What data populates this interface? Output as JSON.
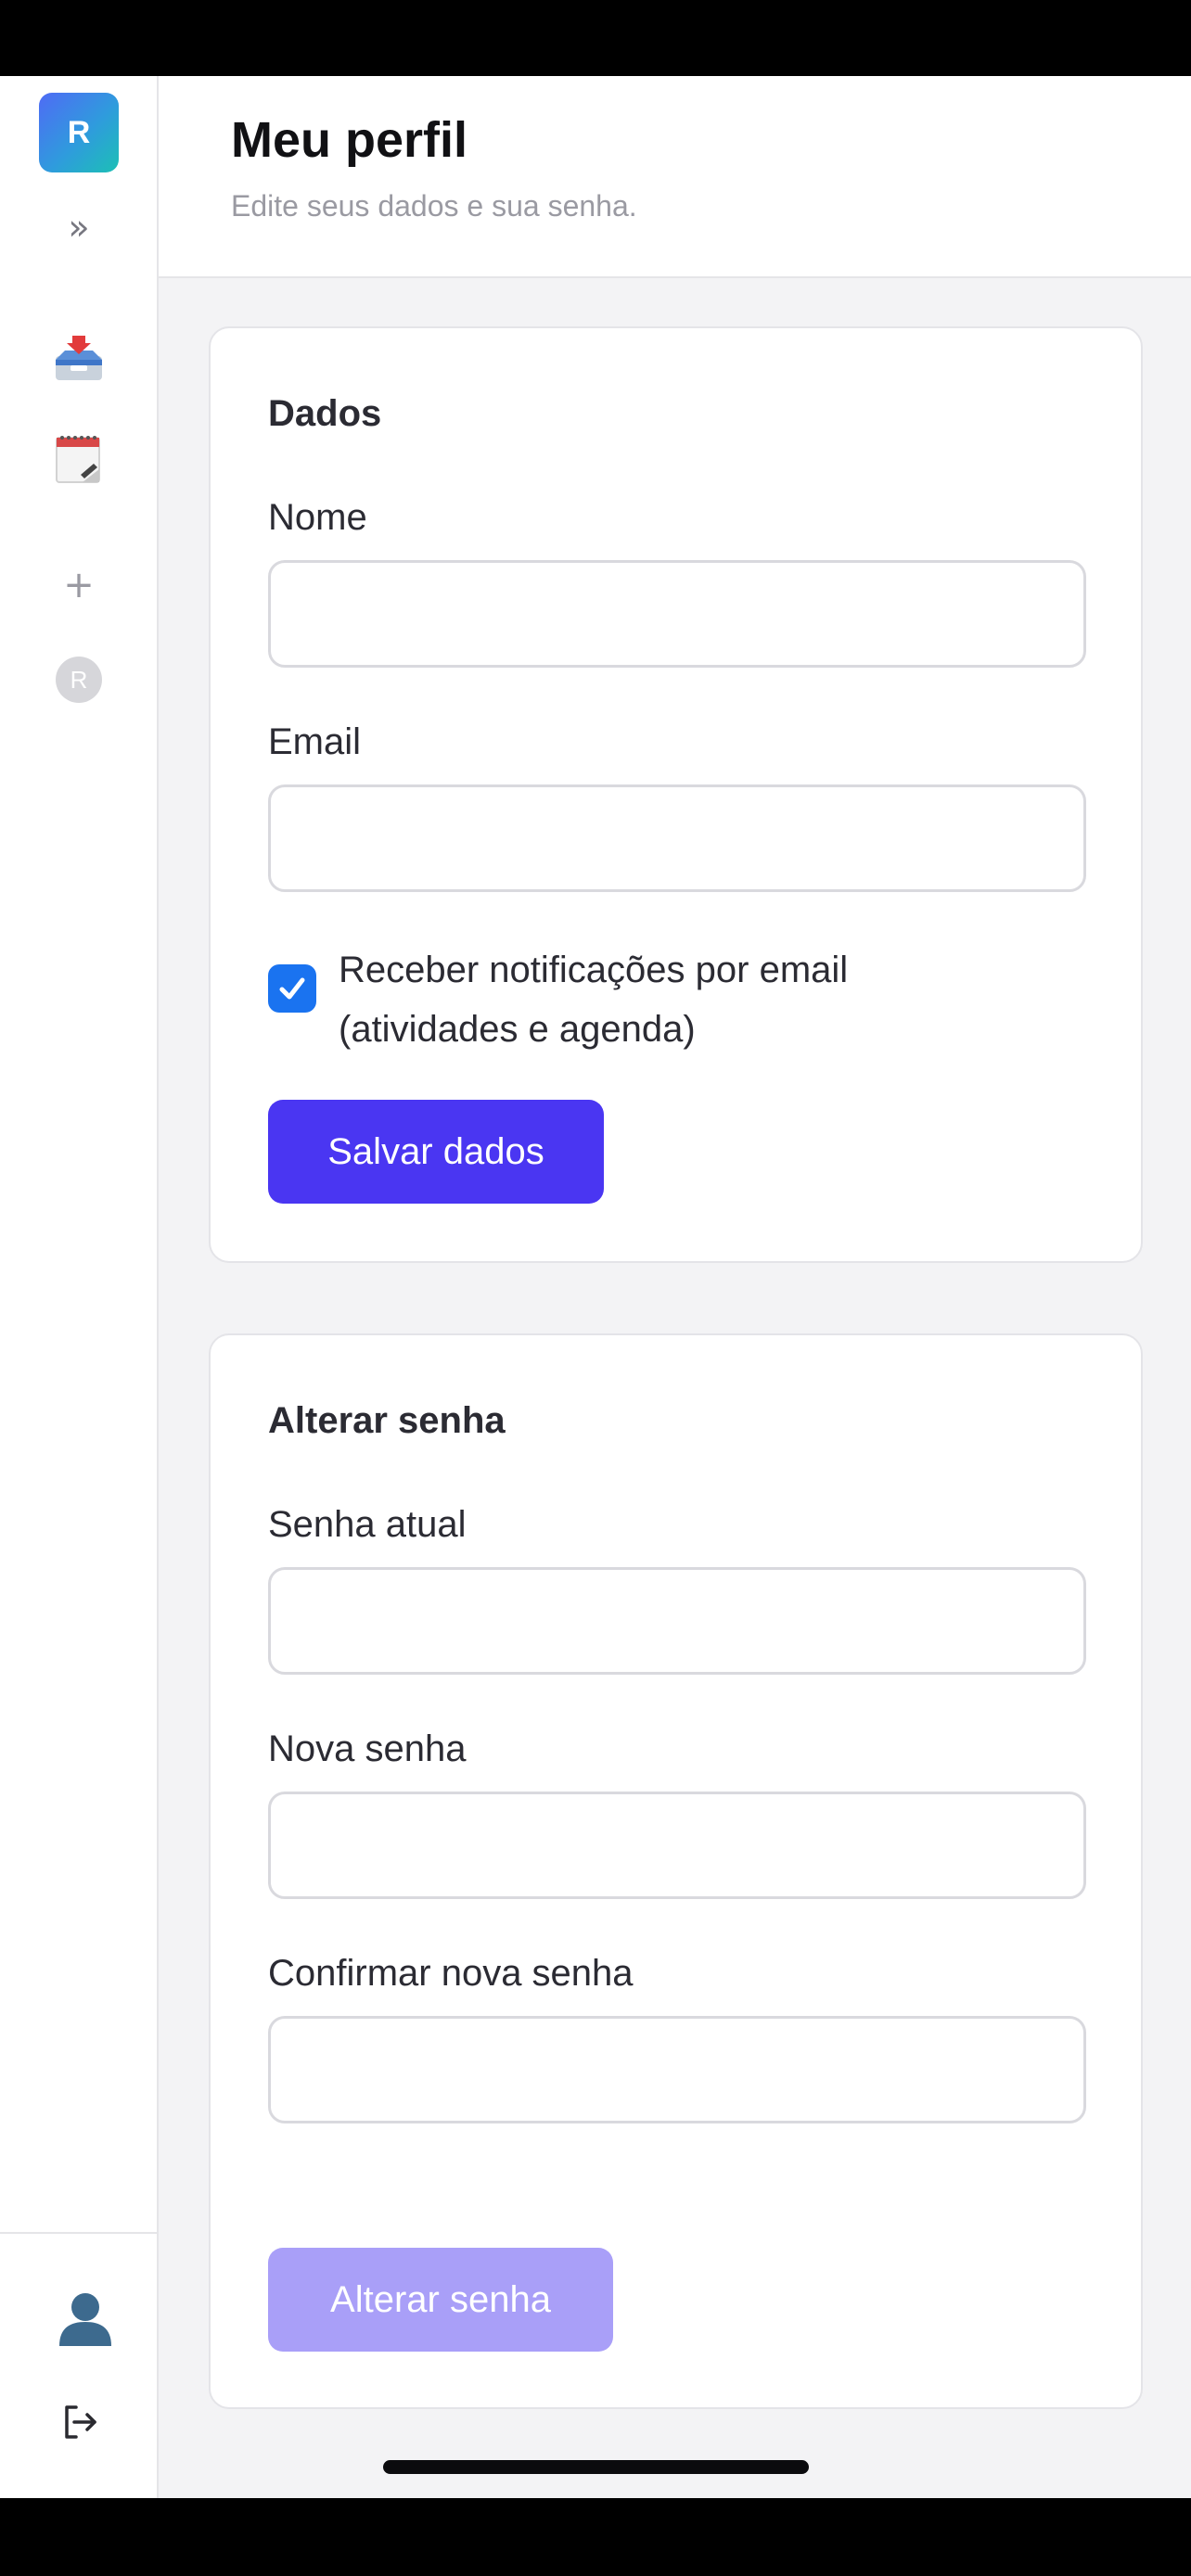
{
  "sidebar": {
    "logo_letter": "R",
    "expand_glyph": "»",
    "nav_items": [
      {
        "icon": "inbox-tray-icon"
      },
      {
        "icon": "calendar-notepad-icon"
      }
    ],
    "add_glyph": "+",
    "workspace_avatar_letter": "R",
    "bottom_items": [
      {
        "icon": "user-profile-icon"
      },
      {
        "icon": "logout-icon"
      }
    ]
  },
  "header": {
    "title": "Meu perfil",
    "subtitle": "Edite seus dados e sua senha."
  },
  "dados_card": {
    "title": "Dados",
    "name_label": "Nome",
    "name_value": "",
    "email_label": "Email",
    "email_value": "",
    "notifications_checked": true,
    "notifications_label_line1": "Receber notificações por email",
    "notifications_label_line2": "(atividades e agenda)",
    "save_label": "Salvar dados"
  },
  "password_card": {
    "title": "Alterar senha",
    "current_label": "Senha atual",
    "new_label": "Nova senha",
    "confirm_label": "Confirmar nova senha",
    "submit_label": "Alterar senha",
    "submit_enabled": false
  },
  "colors": {
    "primary": "#4a36f2",
    "primary_disabled": "#a99ff8",
    "checkbox": "#1a73f0",
    "background": "#f3f3f5"
  }
}
